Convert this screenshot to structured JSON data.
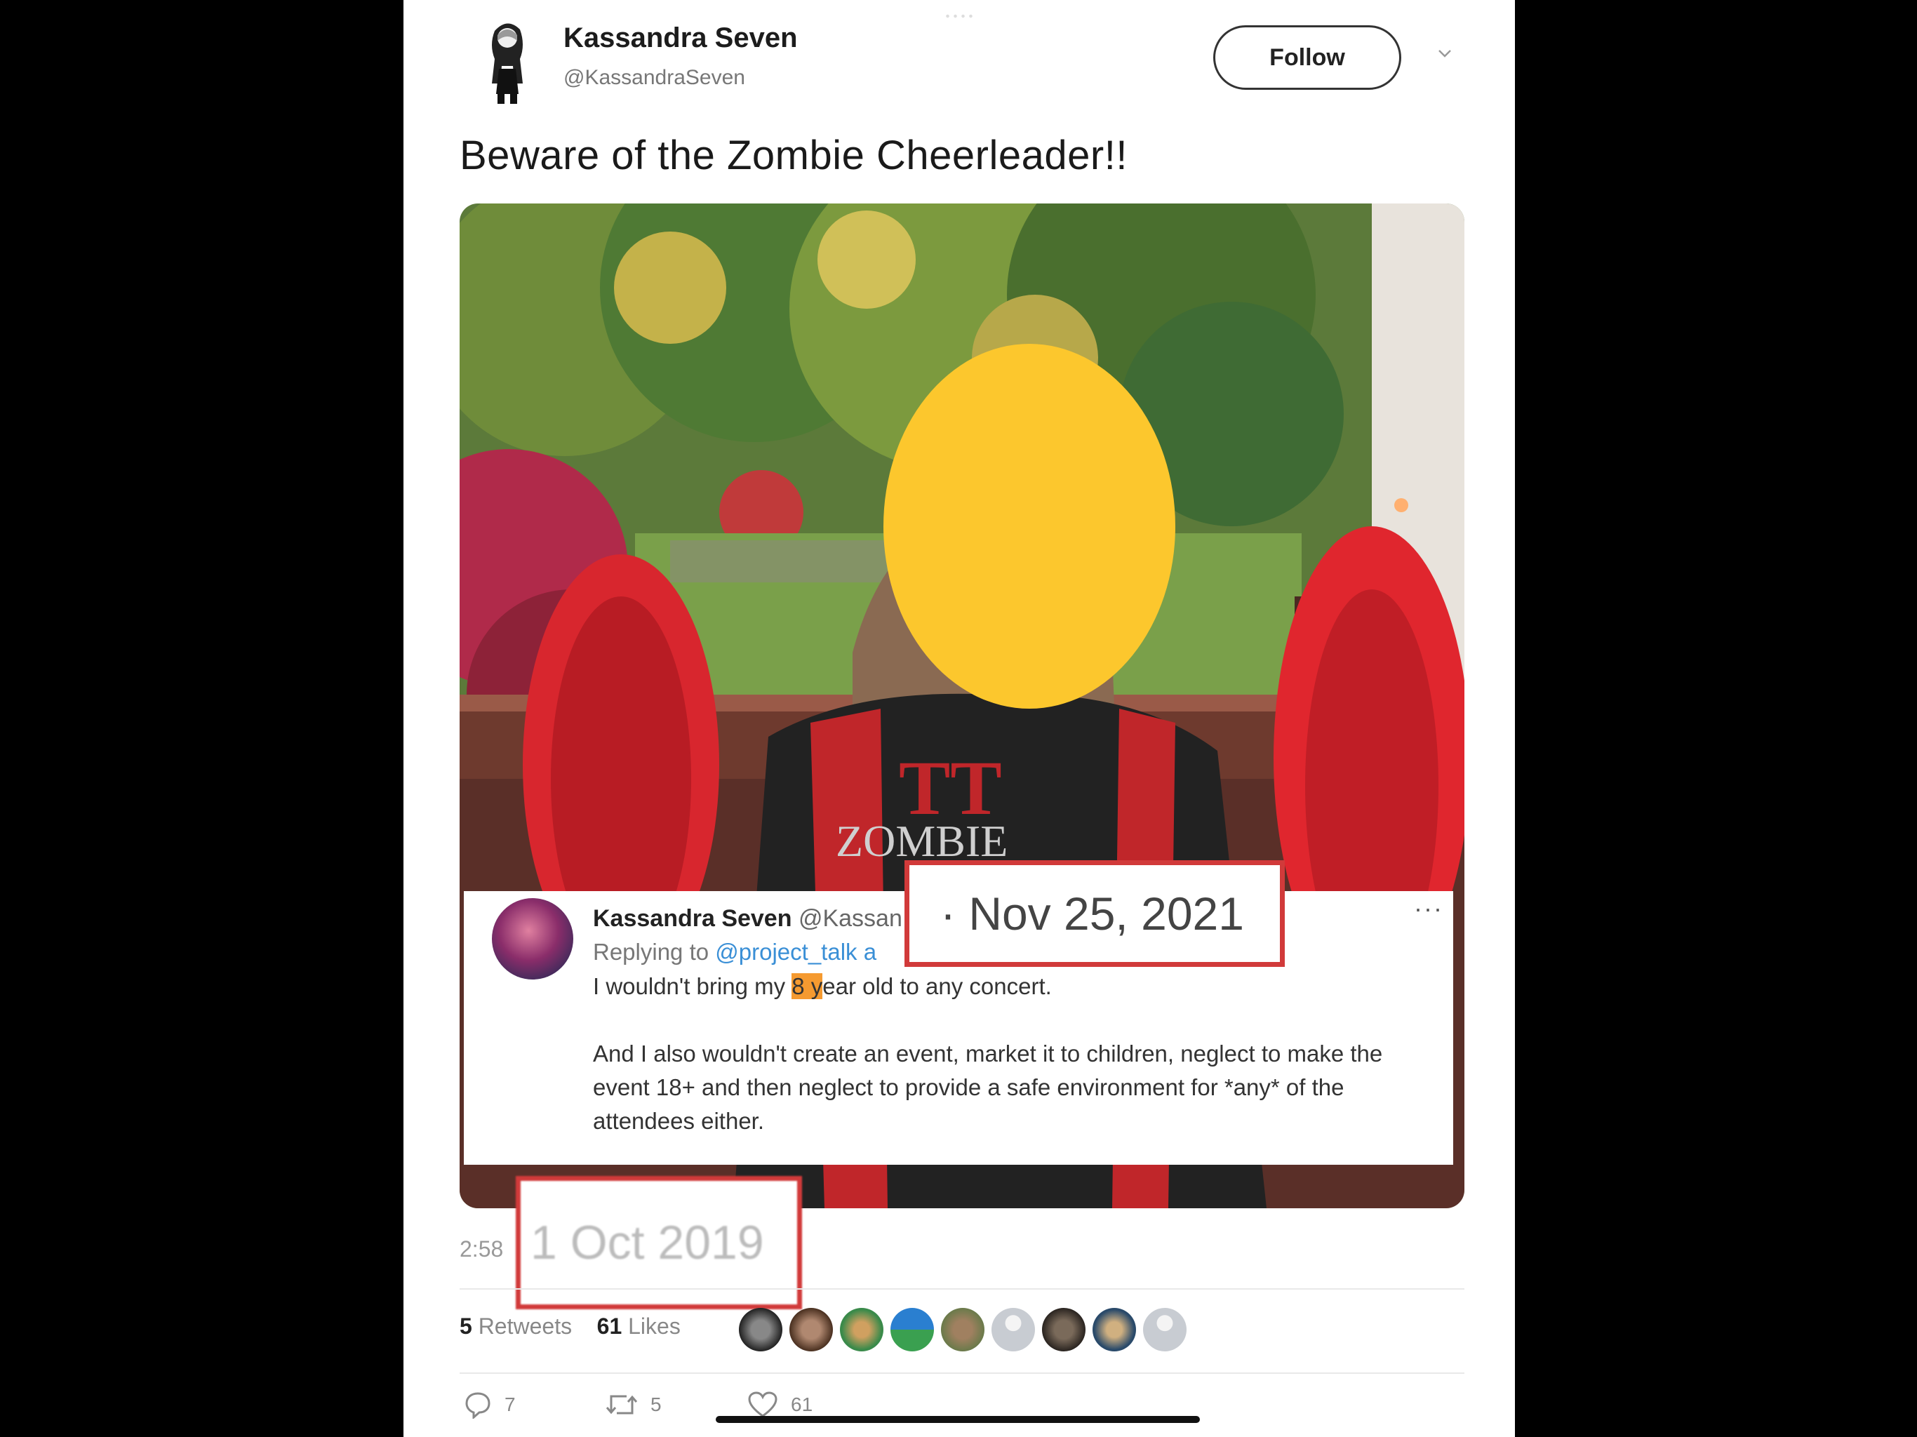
{
  "tweet": {
    "author_name": "Kassandra Seven",
    "author_handle": "@KassandraSeven",
    "follow_label": "Follow",
    "text": "Beware of the Zombie Cheerleader!!",
    "time": "2:58",
    "date": "1 Oct 2019",
    "retweets_count": "5",
    "retweets_label": "Retweets",
    "likes_count": "61",
    "likes_label": "Likes",
    "reply_count": "7",
    "retweet_action_count": "5",
    "like_action_count": "61"
  },
  "photo": {
    "shirt_text": "ZOMBIE"
  },
  "embedded_reply": {
    "name": "Kassandra Seven",
    "handle_partial": "@Kassan",
    "more_label": "···",
    "replying_prefix": "Replying to ",
    "replying_to": "@project_talk a",
    "line1_before": "I wouldn't bring my ",
    "line1_highlight": "8 y",
    "line1_after": "ear old to any concert.",
    "paragraph2": "And I also wouldn't create an event, market it to children, neglect to make the event 18+ and then neglect to provide a safe environment for *any* of the attendees either."
  },
  "annotations": {
    "new_date": "· Nov 25, 2021",
    "box_color": "#d13a3a"
  },
  "colors": {
    "link": "#3a8fd6",
    "highlight": "#f59a30",
    "face_cover": "#fcc72d"
  }
}
